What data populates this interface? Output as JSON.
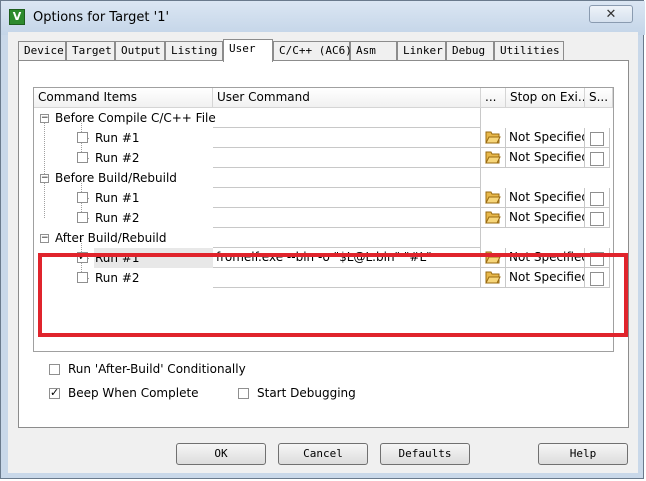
{
  "window": {
    "title": "Options for Target '1'",
    "close_glyph": "✕",
    "app_icon_letter": "V"
  },
  "tabs": [
    {
      "label": "Device"
    },
    {
      "label": "Target"
    },
    {
      "label": "Output"
    },
    {
      "label": "Listing"
    },
    {
      "label": "User"
    },
    {
      "label": "C/C++ (AC6)"
    },
    {
      "label": "Asm"
    },
    {
      "label": "Linker"
    },
    {
      "label": "Debug"
    },
    {
      "label": "Utilities"
    }
  ],
  "active_tab": "User",
  "grid": {
    "headers": {
      "items": "Command Items",
      "command": "User Command",
      "dots": "...",
      "stop": "Stop on Exi...",
      "s": "S..."
    },
    "groups": [
      {
        "label": "Before Compile C/C++ File",
        "expander": "−",
        "runs": [
          {
            "label": "Run #1",
            "checked": false,
            "command": "",
            "stop": "Not Specified"
          },
          {
            "label": "Run #2",
            "checked": false,
            "command": "",
            "stop": "Not Specified"
          }
        ]
      },
      {
        "label": "Before Build/Rebuild",
        "expander": "−",
        "runs": [
          {
            "label": "Run #1",
            "checked": false,
            "command": "",
            "stop": "Not Specified"
          },
          {
            "label": "Run #2",
            "checked": false,
            "command": "",
            "stop": "Not Specified"
          }
        ]
      },
      {
        "label": "After Build/Rebuild",
        "expander": "−",
        "runs": [
          {
            "label": "Run #1",
            "checked": true,
            "command": "fromelf.exe --bin -o \"$L@L.bin\" \"#L\"",
            "stop": "Not Specified"
          },
          {
            "label": "Run #2",
            "checked": false,
            "command": "",
            "stop": "Not Specified"
          }
        ]
      }
    ]
  },
  "options": {
    "run_after_build": {
      "label": "Run 'After-Build' Conditionally",
      "checked": false
    },
    "beep": {
      "label": "Beep When Complete",
      "checked": true
    },
    "start_debugging": {
      "label": "Start Debugging",
      "checked": false
    }
  },
  "buttons": {
    "ok": "OK",
    "cancel": "Cancel",
    "defaults": "Defaults",
    "help": "Help"
  },
  "colors": {
    "highlight": "#e0242c",
    "folder": "#e8b84a"
  }
}
